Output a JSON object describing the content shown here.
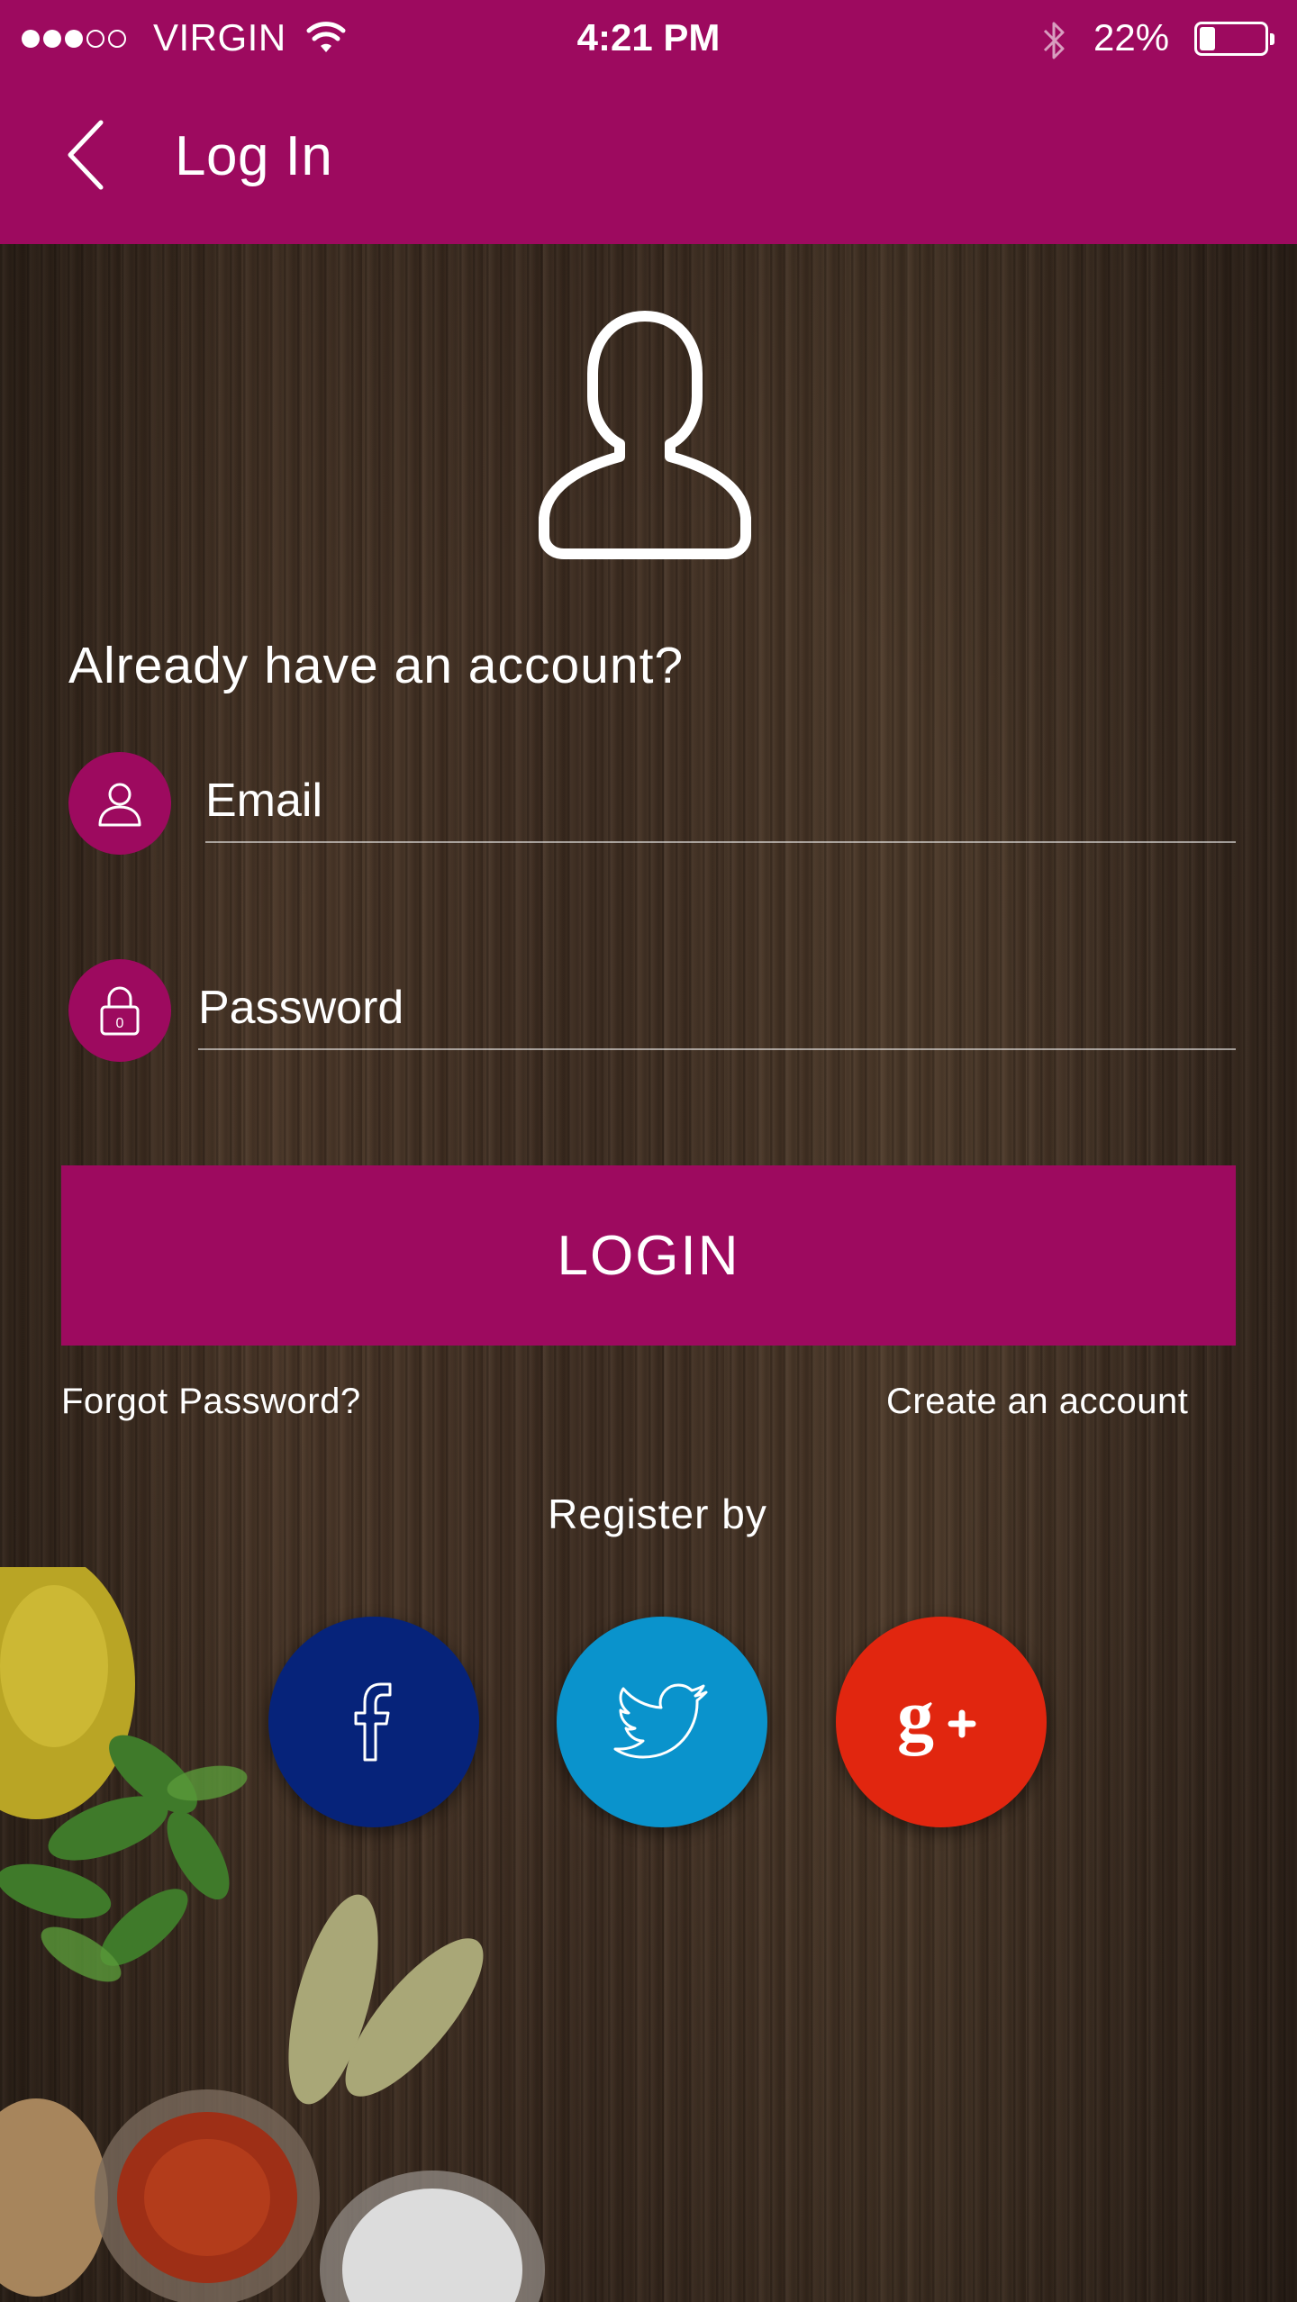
{
  "status_bar": {
    "carrier": "VIRGIN",
    "time": "4:21 PM",
    "battery_percent": "22%",
    "battery_level": 0.22,
    "signal_bars_filled": 3,
    "signal_bars_total": 5
  },
  "header": {
    "title": "Log In"
  },
  "form": {
    "question": "Already have an account?",
    "email_placeholder": "Email",
    "password_placeholder": "Password",
    "login_label": "LOGIN",
    "forgot_label": "Forgot Password?",
    "create_label": "Create an account",
    "register_label": "Register by"
  },
  "social": [
    {
      "name": "facebook",
      "icon": "facebook-icon",
      "color": "#06237a"
    },
    {
      "name": "twitter",
      "icon": "twitter-icon",
      "color": "#0a93cc"
    },
    {
      "name": "google-plus",
      "icon": "google-plus-icon",
      "color": "#e1260f"
    }
  ],
  "colors": {
    "accent": "#9d0a5f",
    "wood": "#3b2a1f"
  }
}
